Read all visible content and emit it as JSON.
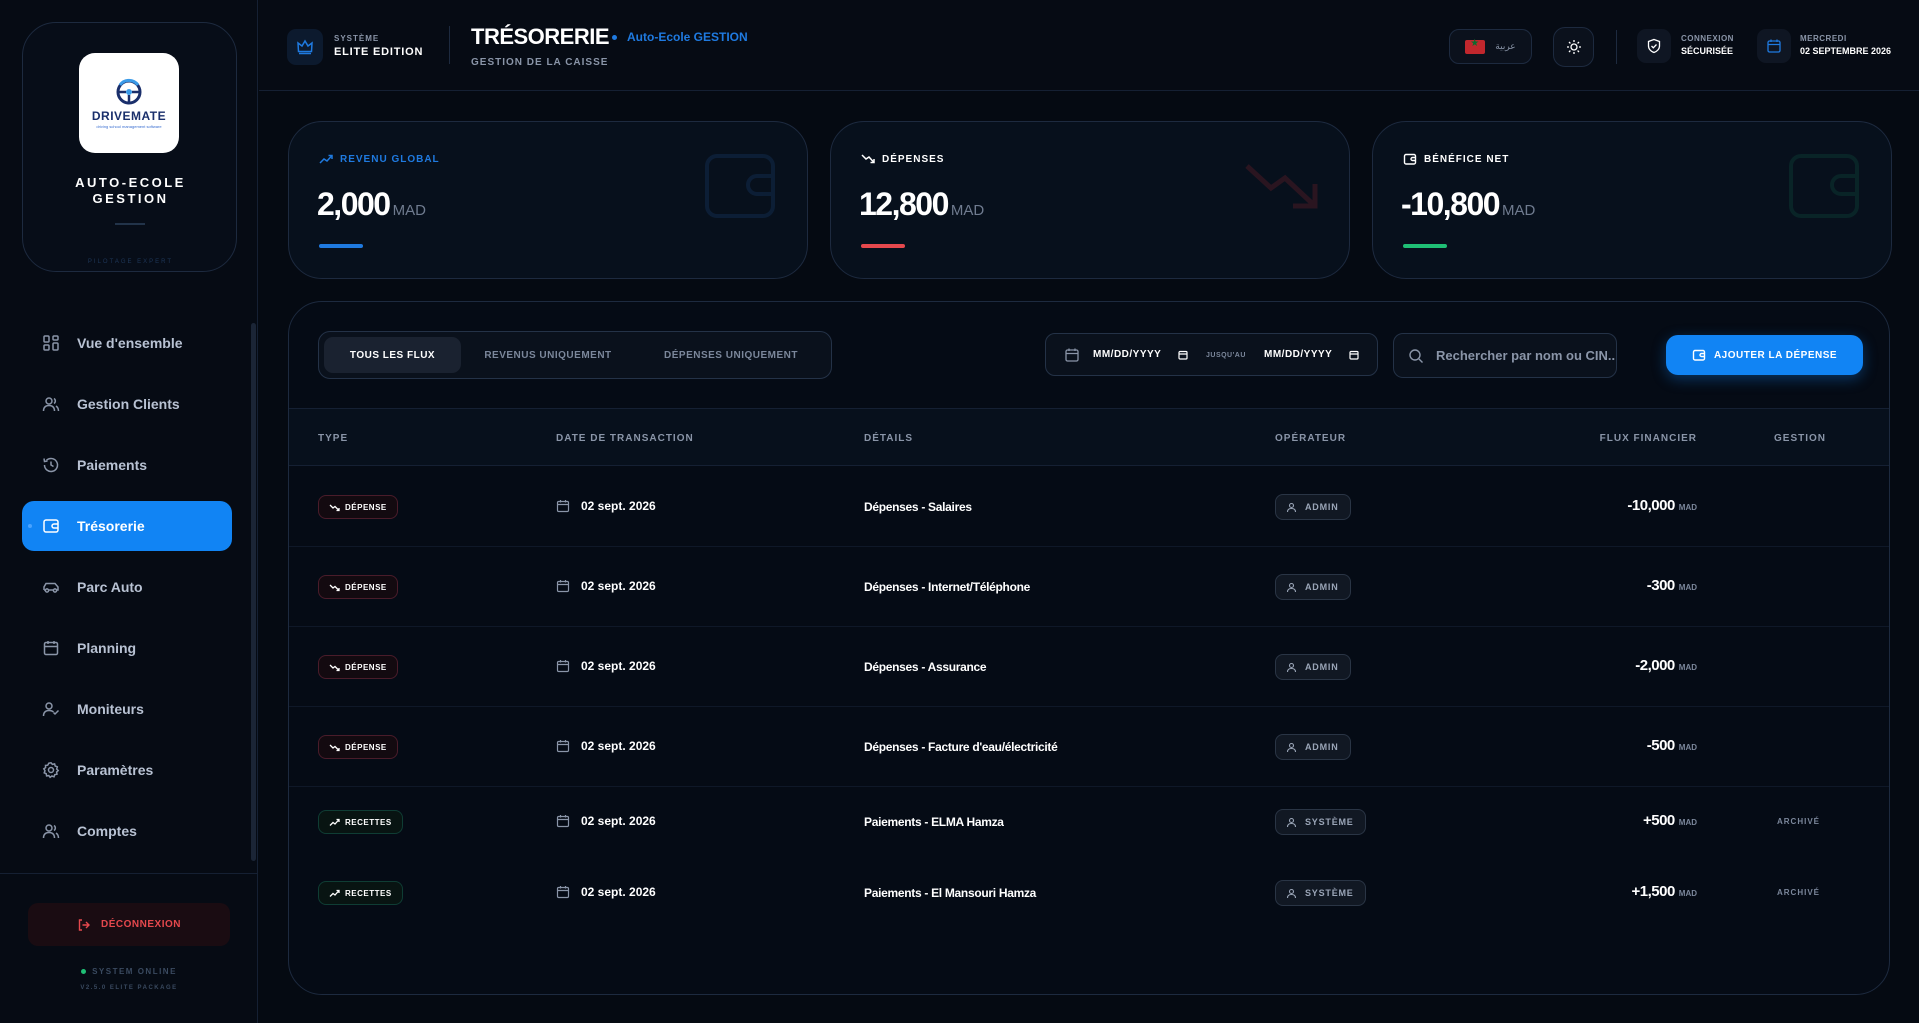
{
  "colors": {
    "accent": "#1184f4",
    "revenue": "#1f7ae0",
    "expense": "#e5484d",
    "profit": "#1fbf75",
    "background": "#050a12"
  },
  "sidebar": {
    "logo_text": "DRIVEMATE",
    "logo_sub": "driving school management software",
    "brand_title": "AUTO-ECOLE GESTION",
    "brand_tag": "PILOTAGE EXPERT",
    "items": [
      {
        "label": "Vue d'ensemble",
        "icon": "dashboard-icon",
        "active": false
      },
      {
        "label": "Gestion Clients",
        "icon": "users-icon",
        "active": false
      },
      {
        "label": "Paiements",
        "icon": "history-icon",
        "active": false
      },
      {
        "label": "Trésorerie",
        "icon": "wallet-icon",
        "active": true
      },
      {
        "label": "Parc Auto",
        "icon": "car-icon",
        "active": false
      },
      {
        "label": "Planning",
        "icon": "calendar-icon",
        "active": false
      },
      {
        "label": "Moniteurs",
        "icon": "user-check-icon",
        "active": false
      },
      {
        "label": "Paramètres",
        "icon": "gear-icon",
        "active": false
      },
      {
        "label": "Comptes",
        "icon": "users-icon",
        "active": false
      }
    ],
    "logout_label": "DÉCONNEXION",
    "status": "SYSTEM ONLINE",
    "version": "V2.5.0 ELITE PACKAGE"
  },
  "header": {
    "system_small": "SYSTÈME",
    "system_big": "ELITE EDITION",
    "title": "TRÉSORERIE",
    "school": "Auto-Ecole GESTION",
    "subtitle": "GESTION DE LA CAISSE",
    "language": "عربية",
    "connection_small": "CONNEXION",
    "connection_big": "SÉCURISÉE",
    "day": "MERCREDI",
    "date": "02 SEPTEMBRE 2026"
  },
  "stats": [
    {
      "label": "REVENU GLOBAL",
      "value": "2,000",
      "unit": "MAD",
      "color": "#1f7ae0"
    },
    {
      "label": "DÉPENSES",
      "value": "12,800",
      "unit": "MAD",
      "color": "#e5484d"
    },
    {
      "label": "BÉNÉFICE NET",
      "value": "-10,800",
      "unit": "MAD",
      "color": "#1fbf75"
    }
  ],
  "filters": {
    "tabs": [
      "TOUS LES FLUX",
      "REVENUS UNIQUEMENT",
      "DÉPENSES UNIQUEMENT"
    ],
    "active_tab": 0,
    "date_from": "MM/DD/YYYY",
    "date_separator": "JUSQU'AU",
    "date_to": "MM/DD/YYYY",
    "search_placeholder": "Rechercher par nom ou CIN...",
    "add_label": "AJOUTER LA DÉPENSE"
  },
  "table": {
    "headers": {
      "type": "TYPE",
      "date": "DATE DE TRANSACTION",
      "details": "DÉTAILS",
      "operator": "OPÉRATEUR",
      "flux": "FLUX FINANCIER",
      "gestion": "GESTION"
    },
    "rows": [
      {
        "type": "DÉPENSE",
        "kind": "expense",
        "date": "02 sept. 2026",
        "details": "Dépenses - Salaires",
        "operator": "ADMIN",
        "amount": "-10,000",
        "unit": "MAD",
        "gestion": ""
      },
      {
        "type": "DÉPENSE",
        "kind": "expense",
        "date": "02 sept. 2026",
        "details": "Dépenses - Internet/Téléphone",
        "operator": "ADMIN",
        "amount": "-300",
        "unit": "MAD",
        "gestion": ""
      },
      {
        "type": "DÉPENSE",
        "kind": "expense",
        "date": "02 sept. 2026",
        "details": "Dépenses - Assurance",
        "operator": "ADMIN",
        "amount": "-2,000",
        "unit": "MAD",
        "gestion": ""
      },
      {
        "type": "DÉPENSE",
        "kind": "expense",
        "date": "02 sept. 2026",
        "details": "Dépenses - Facture d'eau/électricité",
        "operator": "ADMIN",
        "amount": "-500",
        "unit": "MAD",
        "gestion": ""
      },
      {
        "type": "RECETTES",
        "kind": "income",
        "date": "02 sept. 2026",
        "details": "Paiements - ELMA Hamza",
        "operator": "SYSTÈME",
        "amount": "+500",
        "unit": "MAD",
        "gestion": "ARCHIVÉ"
      },
      {
        "type": "RECETTES",
        "kind": "income",
        "date": "02 sept. 2026",
        "details": "Paiements - El Mansouri Hamza",
        "operator": "SYSTÈME",
        "amount": "+1,500",
        "unit": "MAD",
        "gestion": "ARCHIVÉ"
      }
    ]
  }
}
